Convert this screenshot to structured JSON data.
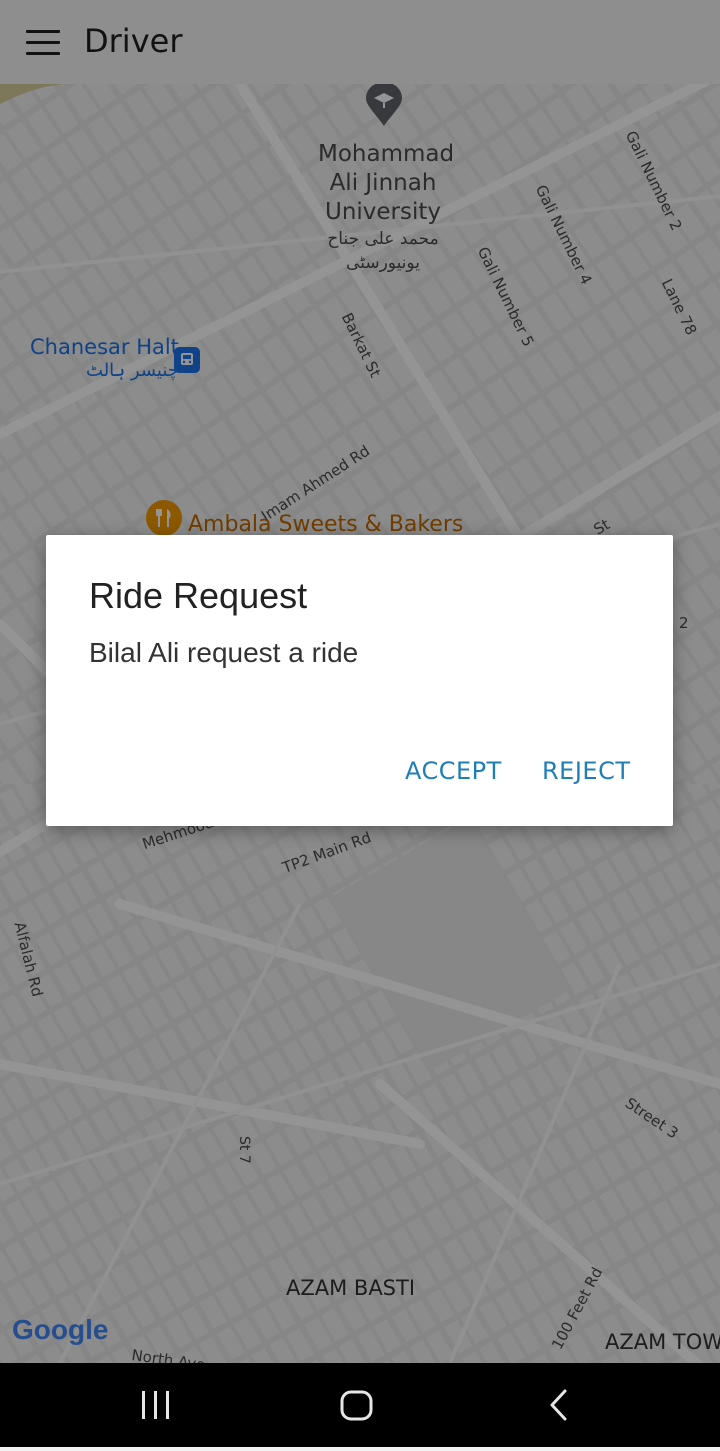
{
  "app_bar": {
    "title": "Driver",
    "menu_icon": "hamburger-menu-icon"
  },
  "map": {
    "labels": {
      "university_en_1": "Mohammad",
      "university_en_2": "Ali Jinnah",
      "university_en_3": "University",
      "university_ur_1": "محمد علی جناح",
      "university_ur_2": "یونیورسٹی",
      "chanesar_en": "Chanesar Halt",
      "chanesar_ur": "چنیسر ہالٹ",
      "gali5": "Gali Number 5",
      "gali4": "Gali Number 4",
      "gali2": "Gali Number 2",
      "lane78": "Lane 78",
      "barkat": "Barkat St",
      "imam": "Imam Ahmed Rd",
      "ambala": "Ambala Sweets & Bakers",
      "st_right": "St",
      "two_right": "2",
      "mehmood": "Mehmood",
      "tp2": "TP2 Main Rd",
      "alfalah": "Alfalah Rd",
      "st7": "St 7",
      "street3": "Street 3",
      "azam_basti": "AZAM BASTI",
      "feet100": "100 Feet Rd",
      "azam_town": "AZAM TOW",
      "north_ave": "North Ave"
    },
    "google_logo": "Google",
    "poi_icons": {
      "university": "graduation-cap-icon",
      "station": "train-icon",
      "restaurant": "fork-knife-icon"
    }
  },
  "dialog": {
    "title": "Ride Request",
    "message": "Bilal Ali request a ride",
    "accept_label": "ACCEPT",
    "reject_label": "REJECT"
  },
  "nav_bar": {
    "recents_icon": "recent-apps-icon",
    "home_icon": "home-icon",
    "back_icon": "back-icon"
  },
  "colors": {
    "accent": "#1f7fb5",
    "app_bar": "#f4f4f4",
    "scrim": "rgba(0,0,0,0.42)",
    "poi_blue": "#1a73e8",
    "poi_orange": "#f29900"
  }
}
